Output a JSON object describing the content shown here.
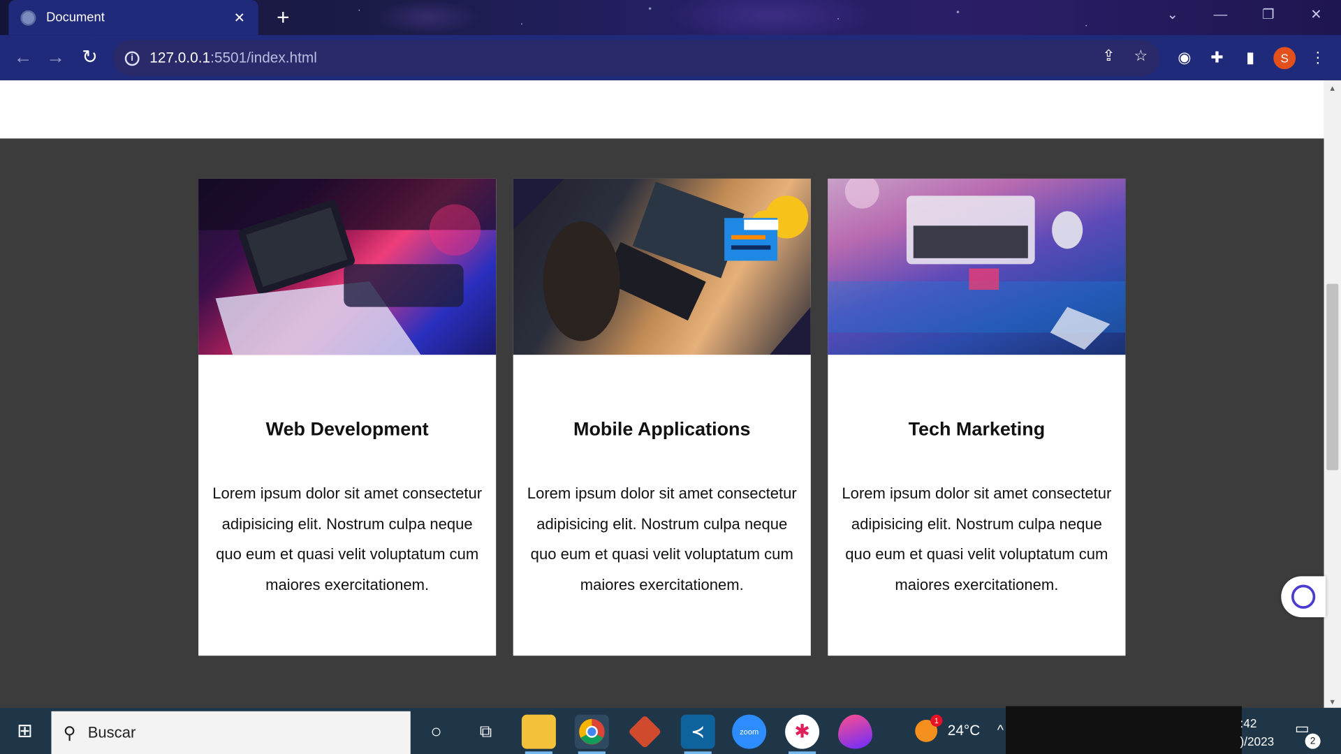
{
  "browser": {
    "tab_title": "Document",
    "tab_close": "✕",
    "new_tab": "+",
    "url_host": "127.0.0.1",
    "url_path": ":5501/index.html",
    "profile_initial": "S"
  },
  "cards": [
    {
      "title": "Web Development",
      "text": "Lorem ipsum dolor sit amet consectetur adipisicing elit. Nostrum culpa neque quo eum et quasi velit voluptatum cum maiores exercitationem."
    },
    {
      "title": "Mobile Applications",
      "text": "Lorem ipsum dolor sit amet consectetur adipisicing elit. Nostrum culpa neque quo eum et quasi velit voluptatum cum maiores exercitationem."
    },
    {
      "title": "Tech Marketing",
      "text": "Lorem ipsum dolor sit amet consectetur adipisicing elit. Nostrum culpa neque quo eum et quasi velit voluptatum cum maiores exercitationem."
    }
  ],
  "taskbar": {
    "search_placeholder": "Buscar",
    "weather_temp": "24°C",
    "weather_badge": "1",
    "clock_time": ":42",
    "clock_date": ")/2023",
    "notification_count": "2"
  },
  "colors": {
    "page_background": "#3c3c3c",
    "card_background": "#ffffff",
    "taskbar_background": "#1f3548",
    "profile_avatar": "#e4501b"
  }
}
